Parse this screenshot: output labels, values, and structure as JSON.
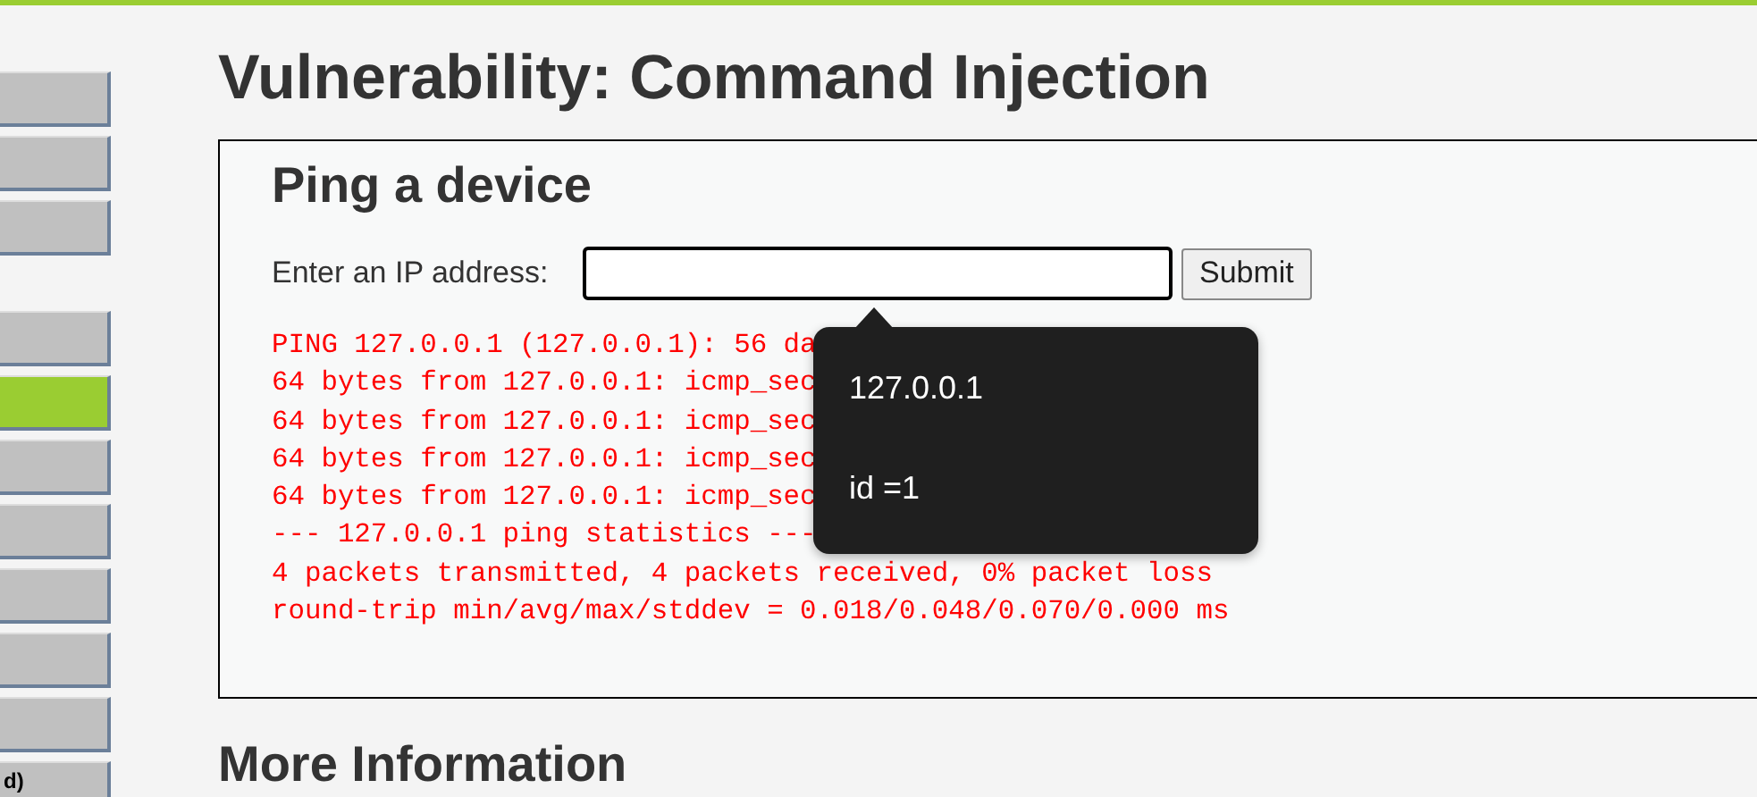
{
  "sidebar": {
    "groups": [
      {
        "items": [
          {
            "selected": false
          },
          {
            "selected": false
          },
          {
            "selected": false
          }
        ]
      },
      {
        "items": [
          {
            "selected": false
          },
          {
            "selected": true
          },
          {
            "selected": false
          },
          {
            "selected": false
          },
          {
            "selected": false
          },
          {
            "selected": false
          },
          {
            "selected": false
          },
          {
            "selected": false,
            "label": "d)"
          }
        ]
      }
    ]
  },
  "page": {
    "title": "Vulnerability: Command Injection",
    "panel": {
      "heading": "Ping a device",
      "label": "Enter an IP address:",
      "button": "Submit",
      "output": [
        "PING 127.0.0.1 (127.0.0.1): 56 da",
        "64 bytes from 127.0.0.1: icmp_sec",
        "64 bytes from 127.0.0.1: icmp_sec",
        "64 bytes from 127.0.0.1: icmp_sec",
        "64 bytes from 127.0.0.1: icmp_sec",
        "--- 127.0.0.1 ping statistics ---",
        "4 packets transmitted, 4 packets received, 0% packet loss",
        "round-trip min/avg/max/stddev = 0.018/0.048/0.070/0.000 ms"
      ]
    },
    "tooltip": {
      "lines": [
        "127.0.0.1",
        "id =1"
      ]
    },
    "more_heading": "More Information"
  }
}
